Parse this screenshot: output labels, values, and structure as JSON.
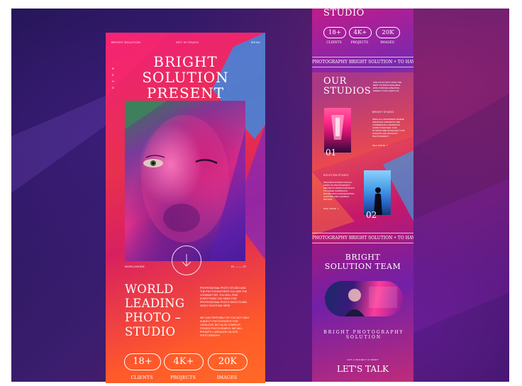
{
  "left_page": {
    "nav": {
      "brand": "BRIGHT SOLUTION",
      "contact": "GET IN TOUCH",
      "menu": "MENU"
    },
    "title": [
      "BRIGHT",
      "SOLUTION",
      "PRESENT"
    ],
    "side_letters": [
      "B",
      "E",
      "H",
      "D"
    ],
    "hero_label_left": "WORLDWIDE",
    "hero_label_right": "01 —— 07",
    "scroll_badge": "SCROLL DOWN • SCROLL DOWN •",
    "heading": [
      "WORLD",
      "LEADING",
      "PHOTO –",
      "STUDIO"
    ],
    "description": "PROFESSIONAL PHOTO STUDIO AND THE PHOTOGRAPHERS YOU ARE THE LOOKING FOR. YOU WILL FIND EVERYTHING YOU NEED FOR PROFESSIONAL PHOTO SHOOTS AND VIDEO SHOOTING HERE.",
    "description2": "WE CAN PERFORM FOR YOU NOT ONLY SUBJECT PHOTOGRAPHY FOR CATALOGS, BUT ALSO COMPLEX STAGED PHOTOGRAPHY. WE WILL PROMPTLY ARRANGE ON-SITE PHOTOGRAPHY.",
    "stats": [
      {
        "value": "18+",
        "label": "CLIENTS"
      },
      {
        "value": "4K+",
        "label": "PROJECTS"
      },
      {
        "value": "20K",
        "label": "IMAGES"
      }
    ]
  },
  "right_page": {
    "top_title": "STUDIO",
    "stats": [
      {
        "value": "18+",
        "label": "CLIENTS"
      },
      {
        "value": "4K+",
        "label": "PROJECTS"
      },
      {
        "value": "20K",
        "label": "IMAGES"
      }
    ],
    "marquee1": "PHOTOGRAPHY BRIGHT SOLUTION • TO HAVE INCREASE",
    "studios_title": [
      "OUR",
      "STUDIOS"
    ],
    "studios_desc": "LIKE US SO WHY HAVE THE BEST STUDIOS AVAILABLE WITH STRONG CREATIVE ENERGY FOR LIFESTYLE",
    "studio1": {
      "name": "BRIGHT STUDIO",
      "text": "IDEAL ALL-ROUNDERS WHERE CREATIVE CONCEPTS AND COMMERCIAL CAMPAIGNS COME TOGETHER. OUR STUDIOS ARE EXCELLENT FOR FASHION AND PRODUCT PHOTOGRAPHY.",
      "link": "SEE MORE  ↗",
      "number": "01"
    },
    "studio2": {
      "name": "SOLUTION STUDIO",
      "text": "SPACIOUS STUDIO FOR ALL KINDS OF PHOTOGRAPHY PROJECTS FROM PORTRAITS TO LARGE CAMPAIGNS. ROOMS WITH PROFESSIONAL LIGHTING AND FLEXIBLE SETUPS.",
      "link": "SEE MORE  ↗",
      "number": "02"
    },
    "marquee2": "PHOTOGRAPHY BRIGHT SOLUTION • TO HAVE INCREASE",
    "team_title": [
      "BRIGHT",
      "SOLUTION TEAM"
    ],
    "arc_text": "BRIGHT PHOTOGRAPHY SOLUTION",
    "cta_small": "GOT A PROJECT IN MIND?",
    "cta": "LET'S TALK"
  }
}
